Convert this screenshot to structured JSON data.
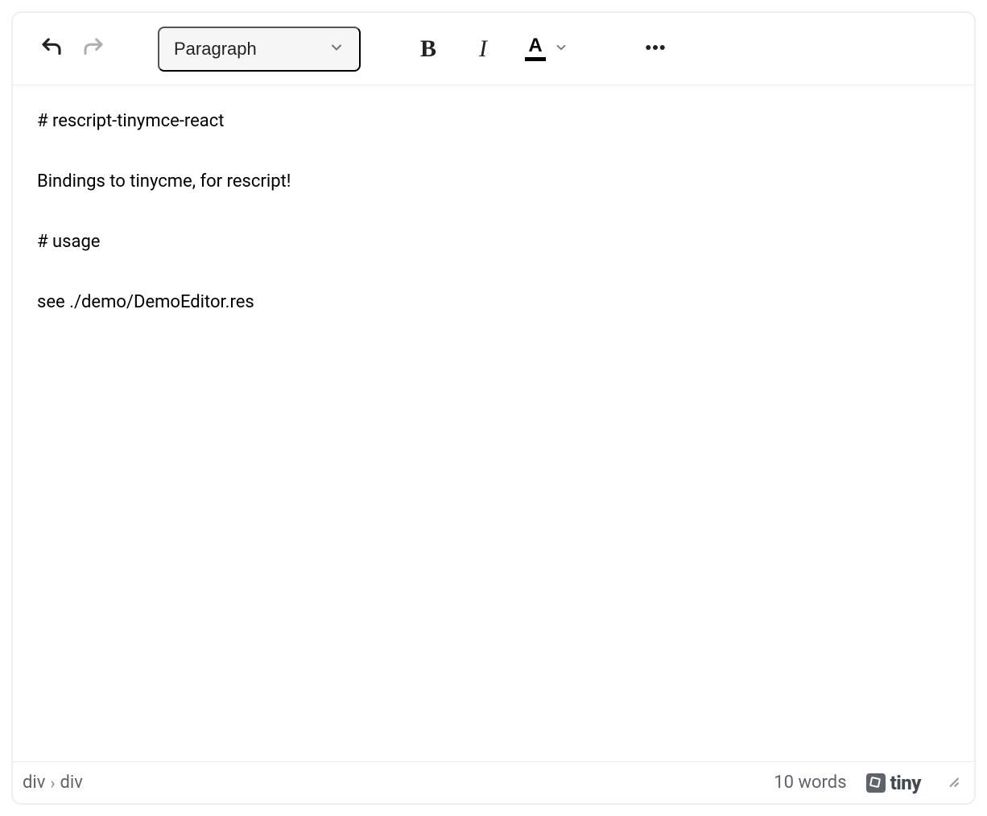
{
  "toolbar": {
    "block_format": "Paragraph",
    "undo_icon": "undo-icon",
    "redo_icon": "redo-icon",
    "bold_label": "B",
    "italic_label": "I",
    "color_label": "A",
    "more_icon": "more-icon"
  },
  "content": {
    "paragraphs": [
      "# rescript-tinymce-react",
      "Bindings to tinycme, for rescript!",
      "# usage",
      "see ./demo/DemoEditor.res"
    ]
  },
  "statusbar": {
    "breadcrumb": [
      "div",
      "div"
    ],
    "wordcount": "10 words",
    "branding": "tiny"
  }
}
